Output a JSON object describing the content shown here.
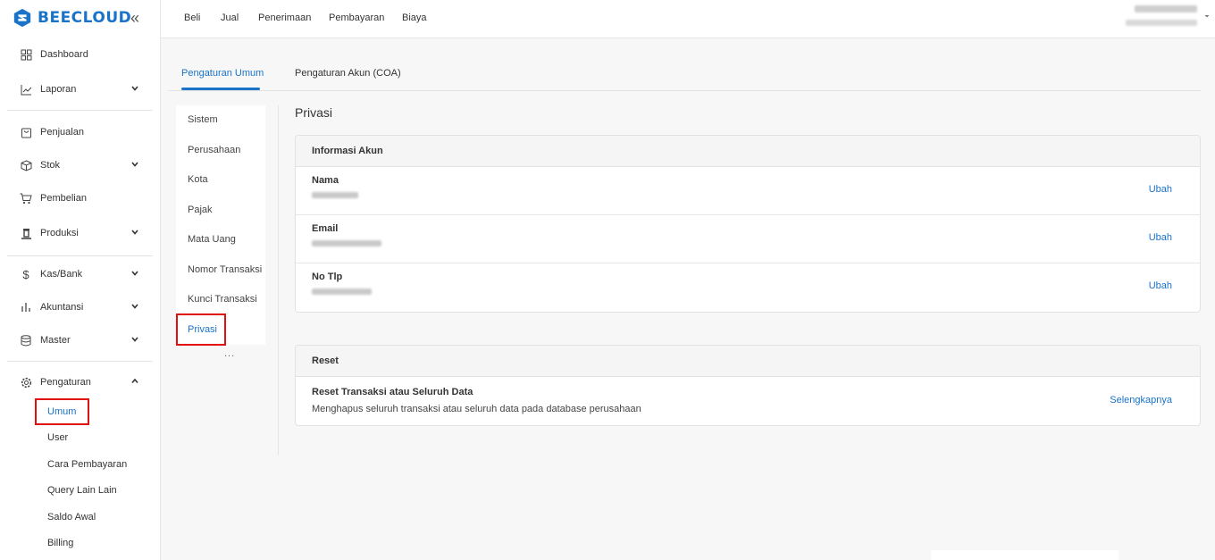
{
  "brand": {
    "name": "BEECLOUD",
    "color": "#1a73c8"
  },
  "sidebar": {
    "collapse_icon": "double-chevron-left-icon",
    "items": [
      {
        "label": "Dashboard",
        "icon": "grid-icon"
      },
      {
        "label": "Laporan",
        "icon": "chart-line-icon"
      },
      {
        "label": "Penjualan",
        "icon": "bag-icon"
      },
      {
        "label": "Stok",
        "icon": "box-icon"
      },
      {
        "label": "Pembelian",
        "icon": "cart-icon"
      },
      {
        "label": "Produksi",
        "icon": "factory-icon"
      },
      {
        "label": "Kas/Bank",
        "icon": "dollar-icon"
      },
      {
        "label": "Akuntansi",
        "icon": "bar-chart-icon"
      },
      {
        "label": "Master",
        "icon": "database-icon"
      },
      {
        "label": "Pengaturan",
        "icon": "gear-icon"
      }
    ],
    "sub_items": [
      "Umum",
      "User",
      "Cara Pembayaran",
      "Query Lain Lain",
      "Saldo Awal",
      "Billing"
    ]
  },
  "topnav": [
    "Beli",
    "Jual",
    "Penerimaan",
    "Pembayaran",
    "Biaya"
  ],
  "tabs": [
    "Pengaturan Umum",
    "Pengaturan Akun (COA)"
  ],
  "submenu": [
    "Sistem",
    "Perusahaan",
    "Kota",
    "Pajak",
    "Mata Uang",
    "Nomor Transaksi",
    "Kunci Transaksi",
    "Privasi"
  ],
  "submenu_more": "...",
  "content": {
    "title": "Privasi",
    "account_card": {
      "title": "Informasi Akun",
      "rows": [
        {
          "label": "Nama",
          "action": "Ubah"
        },
        {
          "label": "Email",
          "action": "Ubah"
        },
        {
          "label": "No Tlp",
          "action": "Ubah"
        }
      ]
    },
    "reset_card": {
      "title": "Reset",
      "row_title": "Reset Transaksi atau Seluruh Data",
      "row_desc": "Menghapus seluruh transaksi atau seluruh data pada database perusahaan",
      "action": "Selengkapnya"
    }
  },
  "colors": {
    "accent": "#1a73c8",
    "highlight": "#e01010"
  }
}
